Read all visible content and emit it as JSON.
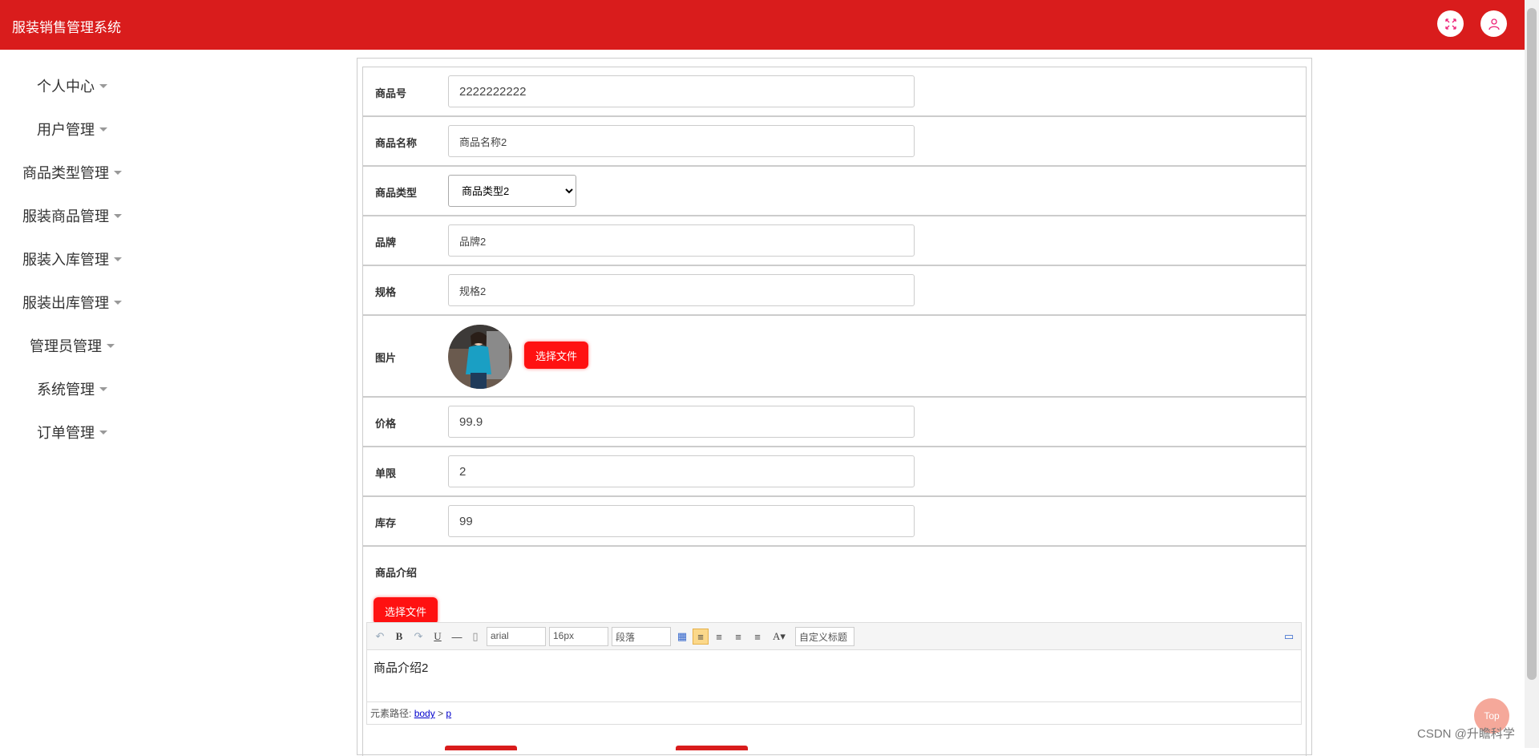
{
  "header": {
    "title": "服装销售管理系统"
  },
  "sidebar": {
    "items": [
      {
        "label": "个人中心"
      },
      {
        "label": "用户管理"
      },
      {
        "label": "商品类型管理"
      },
      {
        "label": "服装商品管理"
      },
      {
        "label": "服装入库管理"
      },
      {
        "label": "服装出库管理"
      },
      {
        "label": "管理员管理"
      },
      {
        "label": "系统管理"
      },
      {
        "label": "订单管理"
      }
    ]
  },
  "form": {
    "product_no": {
      "label": "商品号",
      "value": "2222222222"
    },
    "product_name": {
      "label": "商品名称",
      "value": "商品名称2"
    },
    "product_type": {
      "label": "商品类型",
      "selected": "商品类型2"
    },
    "brand": {
      "label": "品牌",
      "value": "品牌2"
    },
    "spec": {
      "label": "规格",
      "value": "规格2"
    },
    "image": {
      "label": "图片",
      "button": "选择文件"
    },
    "price": {
      "label": "价格",
      "value": "99.9"
    },
    "limit": {
      "label": "单限",
      "value": "2"
    },
    "stock": {
      "label": "库存",
      "value": "99"
    },
    "intro": {
      "label": "商品介绍",
      "button": "选择文件",
      "toolbar": {
        "font": "arial",
        "size": "16px",
        "paragraph": "段落",
        "custom_title": "自定义标题"
      },
      "content": "商品介绍2",
      "status_prefix": "元素路径:",
      "path_body": "body",
      "path_sep": ">",
      "path_p": "p"
    }
  },
  "top_button": "Top",
  "watermark": "CSDN @升瞻科学",
  "colors": {
    "brand": "#d91c1c",
    "button": "#ff1111"
  }
}
